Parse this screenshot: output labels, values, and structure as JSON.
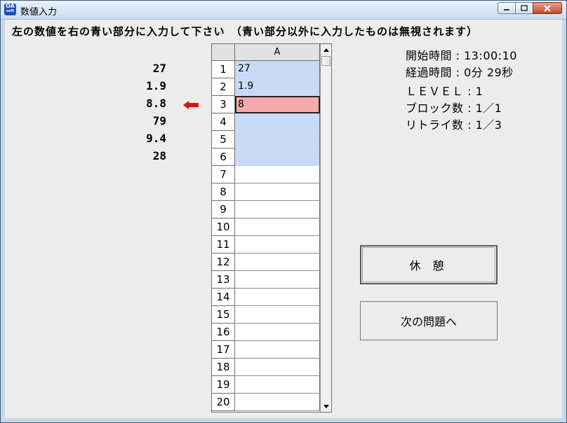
{
  "window": {
    "title": "数値入力",
    "app_icon_text_top": "OA",
    "app_icon_text_bottom": "soft"
  },
  "instruction": "左の数値を右の青い部分に入力して下さい　（青い部分以外に入力したものは無視されます）",
  "source_values": [
    "27",
    "1.9",
    "8.8",
    "79",
    "9.4",
    "28"
  ],
  "current_arrow_icon": "red-left-arrow-icon",
  "grid": {
    "column_header": "A",
    "rows": [
      {
        "num": "1",
        "value": "27",
        "state": "blue"
      },
      {
        "num": "2",
        "value": "1.9",
        "state": "blue"
      },
      {
        "num": "3",
        "value": "8",
        "state": "active"
      },
      {
        "num": "4",
        "value": "",
        "state": "blue"
      },
      {
        "num": "5",
        "value": "",
        "state": "blue"
      },
      {
        "num": "6",
        "value": "",
        "state": "blue"
      },
      {
        "num": "7",
        "value": "",
        "state": "plain"
      },
      {
        "num": "8",
        "value": "",
        "state": "plain"
      },
      {
        "num": "9",
        "value": "",
        "state": "plain"
      },
      {
        "num": "10",
        "value": "",
        "state": "plain"
      },
      {
        "num": "11",
        "value": "",
        "state": "plain"
      },
      {
        "num": "12",
        "value": "",
        "state": "plain"
      },
      {
        "num": "13",
        "value": "",
        "state": "plain"
      },
      {
        "num": "14",
        "value": "",
        "state": "plain"
      },
      {
        "num": "15",
        "value": "",
        "state": "plain"
      },
      {
        "num": "16",
        "value": "",
        "state": "plain"
      },
      {
        "num": "17",
        "value": "",
        "state": "plain"
      },
      {
        "num": "18",
        "value": "",
        "state": "plain"
      },
      {
        "num": "19",
        "value": "",
        "state": "plain"
      },
      {
        "num": "20",
        "value": "",
        "state": "plain"
      }
    ]
  },
  "info": {
    "start_time": "開始時間 : 13:00:10",
    "elapsed": "経過時間 : 0分 29秒",
    "level": "ＬＥＶＥＬ : 1",
    "blocks": "ブロック数 : 1／1",
    "retries": "リトライ数 : 1／3"
  },
  "buttons": {
    "rest": "休 憩",
    "next": "次の問題へ"
  },
  "colors": {
    "input_area": "#c8dbf6",
    "active_cell": "#f7aaae",
    "arrow": "#e01010"
  }
}
